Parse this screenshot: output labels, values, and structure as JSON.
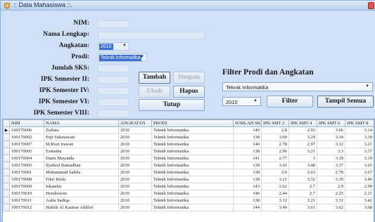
{
  "window": {
    "title": ":: Data Mahasiswa ::."
  },
  "form": {
    "nim_label": "NIM:",
    "nama_label": "Nama Lengkap:",
    "angkatan_label": "Angkatan:",
    "angkatan_value": "2010",
    "prodi_label": "Prodi:",
    "prodi_value": "Teknik Informatika",
    "sks_label": "Jumlah SKS:",
    "ipk2_label": "IPK Semester II:",
    "ipk4_label": "IPK Semester IV:",
    "ipk6_label": "IPK Semester VI:",
    "ipk8_label": "IPK Semester VIII:"
  },
  "buttons": {
    "tambah": "Tambah",
    "simpan": "Simpan",
    "ubah": "Ubah",
    "hapus": "Hapus",
    "tutup": "Tutup"
  },
  "filter": {
    "title": "Filter Prodi dan Angkatan",
    "prodi_value": "Teknik Informatika",
    "angkatan_value": "2010",
    "filter_button": "Filter",
    "show_all_button": "Tampil Semua"
  },
  "table": {
    "columns": [
      "NIM",
      "NAMA",
      "ANGKATAN",
      "PRODI",
      "JUMLAH SKS",
      "IPK SMT 2",
      "IPK SMT 4",
      "IPK SMT 6",
      "IPK SMT 8"
    ],
    "rows": [
      [
        "100170006",
        "Zulfata",
        "2010",
        "Teknik Informatika",
        "140",
        "2.8",
        "2.93",
        "3.06",
        "3.14"
      ],
      [
        "100170002",
        "Puji Sukmawati",
        "2010",
        "Teknik Informatika",
        "138",
        "3.09",
        "3.29",
        "3.34",
        "3.39"
      ],
      [
        "100170007",
        "M.Rozi Irawan",
        "2010",
        "Teknik Informatika",
        "140",
        "2.78",
        "2.97",
        "3.12",
        "3.21"
      ],
      [
        "100170005",
        "Esmaina",
        "2010",
        "Teknik Informatika",
        "138",
        "2.96",
        "3.21",
        "3.3",
        "3.37"
      ],
      [
        "100170004",
        "Dami Mayanda",
        "2010",
        "Teknik Informatika",
        "141",
        "2.77",
        "3",
        "3.18",
        "3.19"
      ],
      [
        "100170003",
        "Syahrul Ramadhan",
        "2010",
        "Teknik Informatika",
        "138",
        "3.41",
        "3.48",
        "3.37",
        "3.65"
      ],
      [
        "100170001",
        "Muhammad Sabila",
        "2010",
        "Teknik Informatika",
        "138",
        "2.6",
        "2.63",
        "2.78",
        "2.67"
      ],
      [
        "100170008",
        "Fikri Rizki",
        "2010",
        "Teknik Informatika",
        "138",
        "3.21",
        "3.32",
        "3.39",
        "3.46"
      ],
      [
        "100170009",
        "Iskandar",
        "2010",
        "Teknik Informatika",
        "143",
        "2.62",
        "2.7",
        "2.9",
        "2.99"
      ],
      [
        "100170010",
        "Hendrawan",
        "2010",
        "Teknik Informatika",
        "140",
        "2.44",
        "2.7",
        "2.25",
        "2.21"
      ],
      [
        "100170011",
        "Aulia Sadiqa",
        "2010",
        "Teknik Informatika",
        "138",
        "3.12",
        "3.21",
        "3.31",
        "3.42"
      ],
      [
        "100170012",
        "Hafizh Al Kautsar Aldilof",
        "2010",
        "Teknik Informatika",
        "144",
        "3.49",
        "3.61",
        "3.62",
        "3.68"
      ]
    ]
  }
}
